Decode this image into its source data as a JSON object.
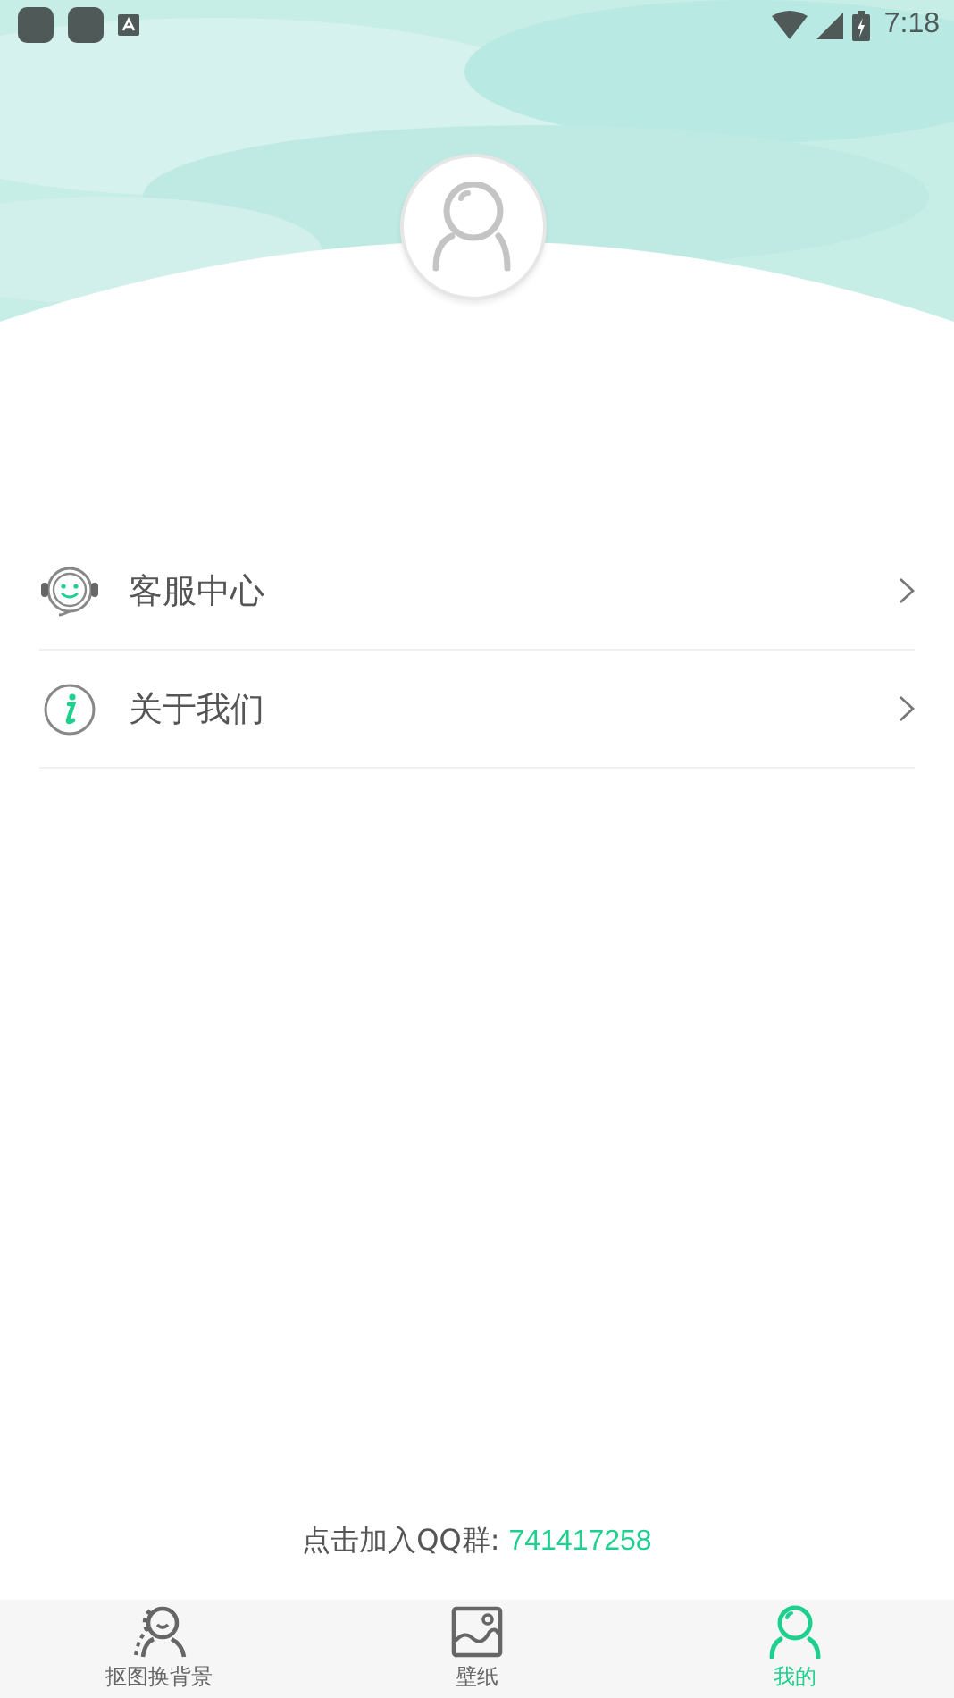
{
  "status_bar": {
    "time": "7:18"
  },
  "menu": [
    {
      "kind": "service",
      "label": "客服中心"
    },
    {
      "kind": "about",
      "label": "关于我们"
    }
  ],
  "footer": {
    "label": "点击加入QQ群:",
    "qq": "741417258"
  },
  "tabs": [
    {
      "kind": "cutout",
      "label": "抠图换背景",
      "selected": false
    },
    {
      "kind": "wallpaper",
      "label": "壁纸",
      "selected": false
    },
    {
      "kind": "me",
      "label": "我的",
      "selected": true
    }
  ]
}
